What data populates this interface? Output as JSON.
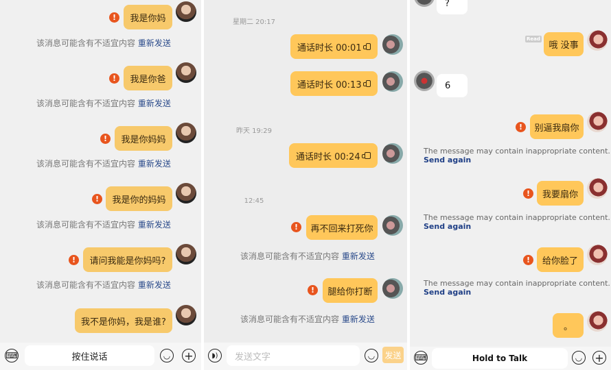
{
  "panel1": {
    "messages": [
      "我是你妈",
      "我是你爸",
      "我是你妈妈",
      "我是你的妈妈",
      "请问我能是你妈吗?",
      "我不是你妈，我是谁?"
    ],
    "warning": "该消息可能含有不适宜内容",
    "resend": "重新发送",
    "hold_to_talk": "按住说话"
  },
  "panel2": {
    "times": [
      "星期二 20:17",
      "昨天 19:29",
      "12:45"
    ],
    "calls": [
      "通话时长 00:01",
      "通话时长 00:13",
      "通话时长 00:24"
    ],
    "messages": [
      "再不回来打死你",
      "腿给你打断"
    ],
    "warning": "该消息可能含有不适宜内容",
    "resend": "重新发送",
    "input_placeholder": "发送文字",
    "send_label": "发送"
  },
  "panel3": {
    "incoming": [
      "?",
      "6"
    ],
    "read_label": "Read",
    "messages": [
      "哦 没事",
      "别逼我扇你",
      "我要扇你",
      "给你脸了",
      "。"
    ],
    "warning": "The message may contain inappropriate content.",
    "resend": "Send again",
    "hold_to_talk": "Hold to Talk"
  },
  "colors": {
    "bubble": "#f7c96b",
    "error": "#e8551e",
    "link": "#2a4a8a"
  }
}
